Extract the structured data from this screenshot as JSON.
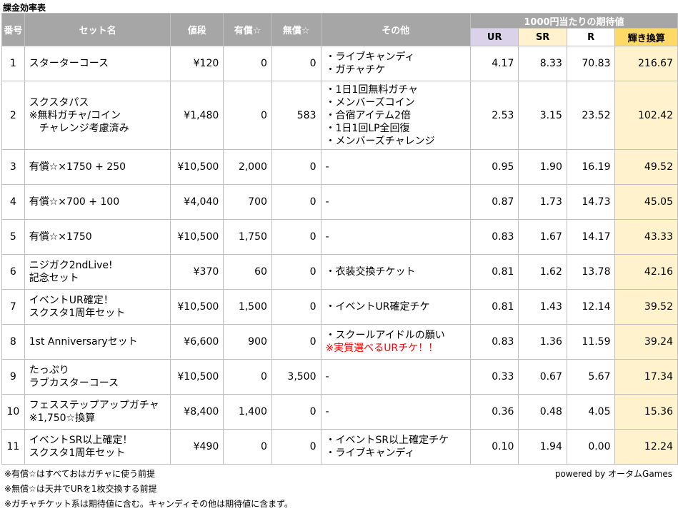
{
  "title": "課金効率表",
  "header": {
    "no": "番号",
    "set_name": "セット名",
    "price": "値段",
    "paid": "有償☆",
    "free": "無償☆",
    "other": "その他",
    "expected": "1000円当たりの期待値",
    "ur": "UR",
    "sr": "SR",
    "r": "R",
    "kagayaki": "輝き換算"
  },
  "rows": [
    {
      "no": "1",
      "name": [
        "スターターコース"
      ],
      "price": "¥120",
      "paid": "0",
      "free": "0",
      "other": [
        "・ライブキャンディ",
        "・ガチャチケ"
      ],
      "other_red": [],
      "ur": "4.17",
      "sr": "8.33",
      "r": "70.83",
      "kg": "216.67"
    },
    {
      "no": "2",
      "name": [
        "スクスタパス",
        "※無料ガチャ/コイン",
        "　チャレンジ考慮済み"
      ],
      "price": "¥1,480",
      "paid": "0",
      "free": "583",
      "other": [
        "・1日1回無料ガチャ",
        "・メンバーズコイン",
        "・合宿アイテム2倍",
        "・1日1回LP全回復",
        "・メンバーズチャレンジ"
      ],
      "other_red": [],
      "ur": "2.53",
      "sr": "3.15",
      "r": "23.52",
      "kg": "102.42"
    },
    {
      "no": "3",
      "name": [
        "有償☆×1750 + 250"
      ],
      "price": "¥10,500",
      "paid": "2,000",
      "free": "0",
      "other": [
        "-"
      ],
      "other_red": [],
      "ur": "0.95",
      "sr": "1.90",
      "r": "16.19",
      "kg": "49.52"
    },
    {
      "no": "4",
      "name": [
        "有償☆×700 + 100"
      ],
      "price": "¥4,040",
      "paid": "700",
      "free": "0",
      "other": [
        "-"
      ],
      "other_red": [],
      "ur": "0.87",
      "sr": "1.73",
      "r": "14.73",
      "kg": "45.05"
    },
    {
      "no": "5",
      "name": [
        "有償☆×1750"
      ],
      "price": "¥10,500",
      "paid": "1,750",
      "free": "0",
      "other": [
        "-"
      ],
      "other_red": [],
      "ur": "0.83",
      "sr": "1.67",
      "r": "14.17",
      "kg": "43.33"
    },
    {
      "no": "6",
      "name": [
        "ニジガク2ndLive!",
        "記念セット"
      ],
      "price": "¥370",
      "paid": "60",
      "free": "0",
      "other": [
        "・衣装交換チケット"
      ],
      "other_red": [],
      "ur": "0.81",
      "sr": "1.62",
      "r": "13.78",
      "kg": "42.16"
    },
    {
      "no": "7",
      "name": [
        "イベントUR確定！",
        "スクスタ1周年セット"
      ],
      "price": "¥10,500",
      "paid": "1,500",
      "free": "0",
      "other": [
        "・イベントUR確定チケ"
      ],
      "other_red": [],
      "ur": "0.81",
      "sr": "1.43",
      "r": "12.14",
      "kg": "39.52"
    },
    {
      "no": "8",
      "name": [
        "1st Anniversaryセット"
      ],
      "price": "¥6,600",
      "paid": "900",
      "free": "0",
      "other": [
        "・スクールアイドルの願い"
      ],
      "other_red": [
        "※実質選べるURチケ！！"
      ],
      "ur": "0.83",
      "sr": "1.36",
      "r": "11.59",
      "kg": "39.24"
    },
    {
      "no": "9",
      "name": [
        "たっぷり",
        "ラブカスターコース"
      ],
      "price": "¥10,500",
      "paid": "0",
      "free": "3,500",
      "other": [
        "-"
      ],
      "other_red": [],
      "ur": "0.33",
      "sr": "0.67",
      "r": "5.67",
      "kg": "17.34"
    },
    {
      "no": "10",
      "name": [
        "フェスステップアップガチャ",
        "※1,750☆換算"
      ],
      "price": "¥8,400",
      "paid": "1,400",
      "free": "0",
      "other": [
        "-"
      ],
      "other_red": [],
      "ur": "0.36",
      "sr": "0.48",
      "r": "4.05",
      "kg": "15.36"
    },
    {
      "no": "11",
      "name": [
        "イベントSR以上確定！",
        "スクスタ1周年セット"
      ],
      "price": "¥490",
      "paid": "0",
      "free": "0",
      "other": [
        "・イベントSR以上確定チケ",
        "・ライブキャンディ"
      ],
      "other_red": [],
      "ur": "0.10",
      "sr": "1.94",
      "r": "0.00",
      "kg": "12.24"
    }
  ],
  "footer": {
    "note1": "※有償☆はすべておはガチャに使う前提",
    "note2": "※無償☆は天井でURを1枚交換する前提",
    "note3": "※ガチャチケット系は期待値に含む。キャンディその他は期待値に含まず。",
    "credit": "powered by オータムGames"
  },
  "colors": {
    "header_bg": "#a6a6a6",
    "ur_bg": "#d9d2e9",
    "sr_bg": "#fff2cc",
    "kagayaki_header_bg": "#ffd966",
    "kagayaki_cell_bg": "#fff2cc",
    "red_note": "#ff0000"
  }
}
